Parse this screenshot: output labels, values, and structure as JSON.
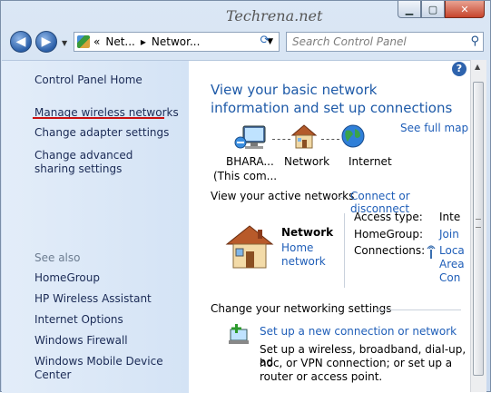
{
  "window": {
    "watermark": "Techrena.net",
    "minimize": "▁",
    "maximize": "▢",
    "close": "✕"
  },
  "nav": {
    "back": "◀",
    "forward": "▶",
    "breadcrumb": [
      "«",
      "Net...",
      "▸",
      "Networ..."
    ],
    "search_placeholder": "Search Control Panel"
  },
  "sidebar": {
    "items": [
      {
        "label": "Control Panel Home"
      },
      {
        "label": "Manage wireless networks"
      },
      {
        "label": "Change adapter settings"
      },
      {
        "label": "Change advanced sharing settings"
      }
    ],
    "see_also_label": "See also",
    "see_also": [
      {
        "label": "HomeGroup"
      },
      {
        "label": "HP Wireless Assistant"
      },
      {
        "label": "Internet Options"
      },
      {
        "label": "Windows Firewall"
      },
      {
        "label": "Windows Mobile Device Center"
      }
    ]
  },
  "main": {
    "help": "?",
    "heading": "View your basic network information and set up connections",
    "see_full_map": "See full map",
    "map": {
      "computer_name": "BHARA...",
      "computer_sub": "(This com...",
      "network": "Network",
      "internet": "Internet"
    },
    "active_networks_label": "View your active networks",
    "connect_disconnect": "Connect or disconnect",
    "network_card": {
      "name": "Network",
      "type_link_line1": "Home",
      "type_link_line2": "network",
      "access_type_label": "Access type:",
      "access_type_value": "Inte",
      "homegroup_label": "HomeGroup:",
      "homegroup_value": "Join",
      "connections_label": "Connections:",
      "connections_value1": "Loca",
      "connections_value2": "Area",
      "connections_value3": "Con"
    },
    "change_settings_label": "Change your networking settings",
    "setup": {
      "title": "Set up a new connection or network",
      "desc1": "Set up a wireless, broadband, dial-up, ad",
      "desc2": "hoc, or VPN connection; or set up a",
      "desc3": "router or access point."
    }
  }
}
